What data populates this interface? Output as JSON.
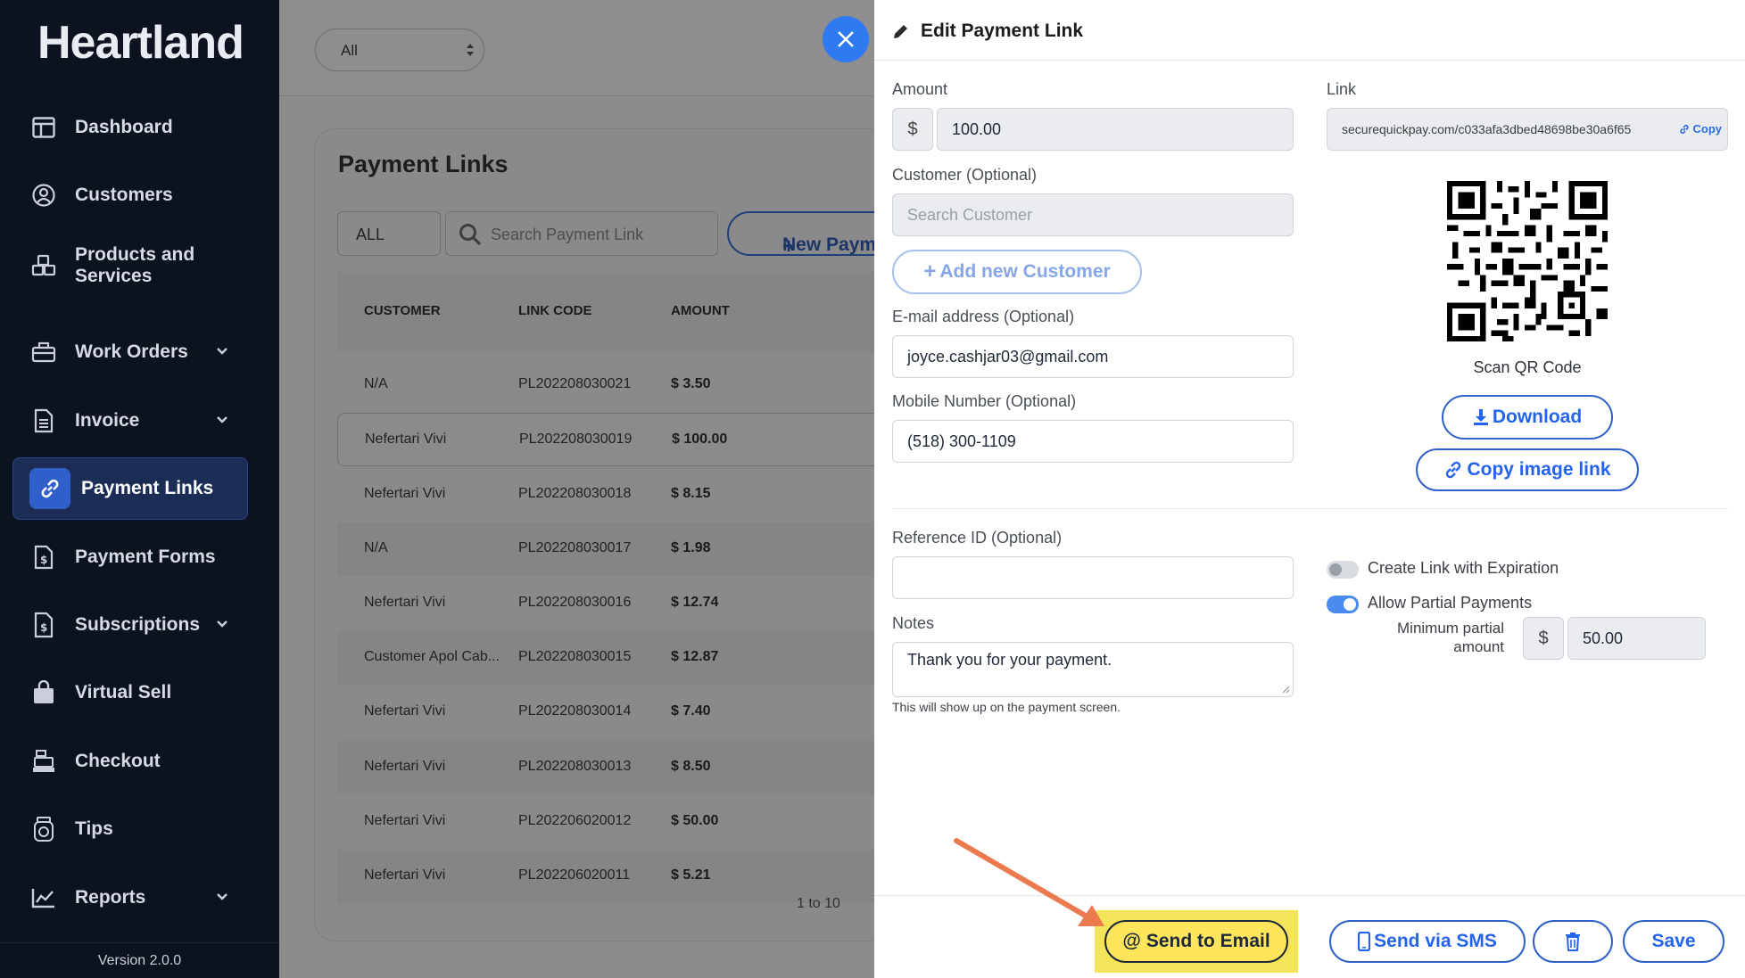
{
  "brand": "Heartland",
  "version": "Version 2.0.0",
  "sidebar": {
    "items": [
      {
        "label": "Dashboard",
        "icon": "dashboard-icon"
      },
      {
        "label": "Customers",
        "icon": "user-circle-icon"
      },
      {
        "label": "Products and Services",
        "icon": "cubes-icon"
      },
      {
        "label": "Work Orders",
        "icon": "toolbox-icon",
        "expandable": true
      },
      {
        "label": "Invoice",
        "icon": "document-icon",
        "expandable": true
      },
      {
        "label": "Payment Links",
        "icon": "link-icon",
        "active": true
      },
      {
        "label": "Payment Forms",
        "icon": "dollar-file-icon"
      },
      {
        "label": "Subscriptions",
        "icon": "dollar-file-icon",
        "expandable": true
      },
      {
        "label": "Virtual Sell",
        "icon": "shopping-bag-icon"
      },
      {
        "label": "Checkout",
        "icon": "cash-register-icon"
      },
      {
        "label": "Tips",
        "icon": "coin-jar-icon"
      },
      {
        "label": "Reports",
        "icon": "chart-line-icon",
        "expandable": true
      }
    ]
  },
  "topbar": {
    "filter_value": "All"
  },
  "payment_links": {
    "title": "Payment Links",
    "filter": "ALL",
    "search_placeholder": "Search Payment Link",
    "new_button": "New Paym",
    "columns": [
      "CUSTOMER",
      "LINK CODE",
      "AMOUNT"
    ],
    "rows": [
      {
        "customer": "N/A",
        "code": "PL202208030021",
        "amount": "$ 3.50"
      },
      {
        "customer": "Nefertari Vivi",
        "code": "PL202208030019",
        "amount": "$ 100.00"
      },
      {
        "customer": "Nefertari Vivi",
        "code": "PL202208030018",
        "amount": "$ 8.15"
      },
      {
        "customer": "N/A",
        "code": "PL202208030017",
        "amount": "$ 1.98"
      },
      {
        "customer": "Nefertari Vivi",
        "code": "PL202208030016",
        "amount": "$ 12.74"
      },
      {
        "customer": "Customer Apol Cab...",
        "code": "PL202208030015",
        "amount": "$ 12.87"
      },
      {
        "customer": "Nefertari Vivi",
        "code": "PL202208030014",
        "amount": "$ 7.40"
      },
      {
        "customer": "Nefertari Vivi",
        "code": "PL202208030013",
        "amount": "$ 8.50"
      },
      {
        "customer": "Nefertari Vivi",
        "code": "PL202206020012",
        "amount": "$ 50.00"
      },
      {
        "customer": "Nefertari Vivi",
        "code": "PL202206020011",
        "amount": "$ 5.21"
      }
    ],
    "pager": "1 to 10"
  },
  "edit_panel": {
    "title": "Edit Payment Link",
    "amount_label": "Amount",
    "currency_symbol": "$",
    "amount_value": "100.00",
    "customer_label": "Customer (Optional)",
    "customer_placeholder": "Search Customer",
    "add_customer_button": "Add new Customer",
    "email_label": "E-mail address (Optional)",
    "email_value": "joyce.cashjar03@gmail.com",
    "mobile_label": "Mobile Number (Optional)",
    "mobile_value": "(518) 300-1109",
    "link_label": "Link",
    "link_value": "securequickpay.com/c033afa3dbed48698be30a6f65",
    "copy_label": "Copy",
    "scan_label": "Scan QR Code",
    "download_button": "Download",
    "copy_image_button": "Copy image link",
    "reference_label": "Reference ID (Optional)",
    "reference_value": "",
    "notes_label": "Notes",
    "notes_value": "Thank you for your payment.",
    "notes_hint": "This will show up on the payment screen.",
    "expiration_toggle_label": "Create Link with Expiration",
    "expiration_enabled": false,
    "partial_toggle_label": "Allow Partial Payments",
    "partial_enabled": true,
    "min_partial_label": "Minimum partial amount",
    "min_partial_value": "50.00",
    "footer": {
      "send_email": "Send to Email",
      "send_sms": "Send via SMS",
      "save": "Save"
    }
  },
  "colors": {
    "sidebar_bg": "#0d1220",
    "accent": "#2f60c9",
    "highlight": "#f5e35a",
    "arrow": "#ec7a4f"
  }
}
